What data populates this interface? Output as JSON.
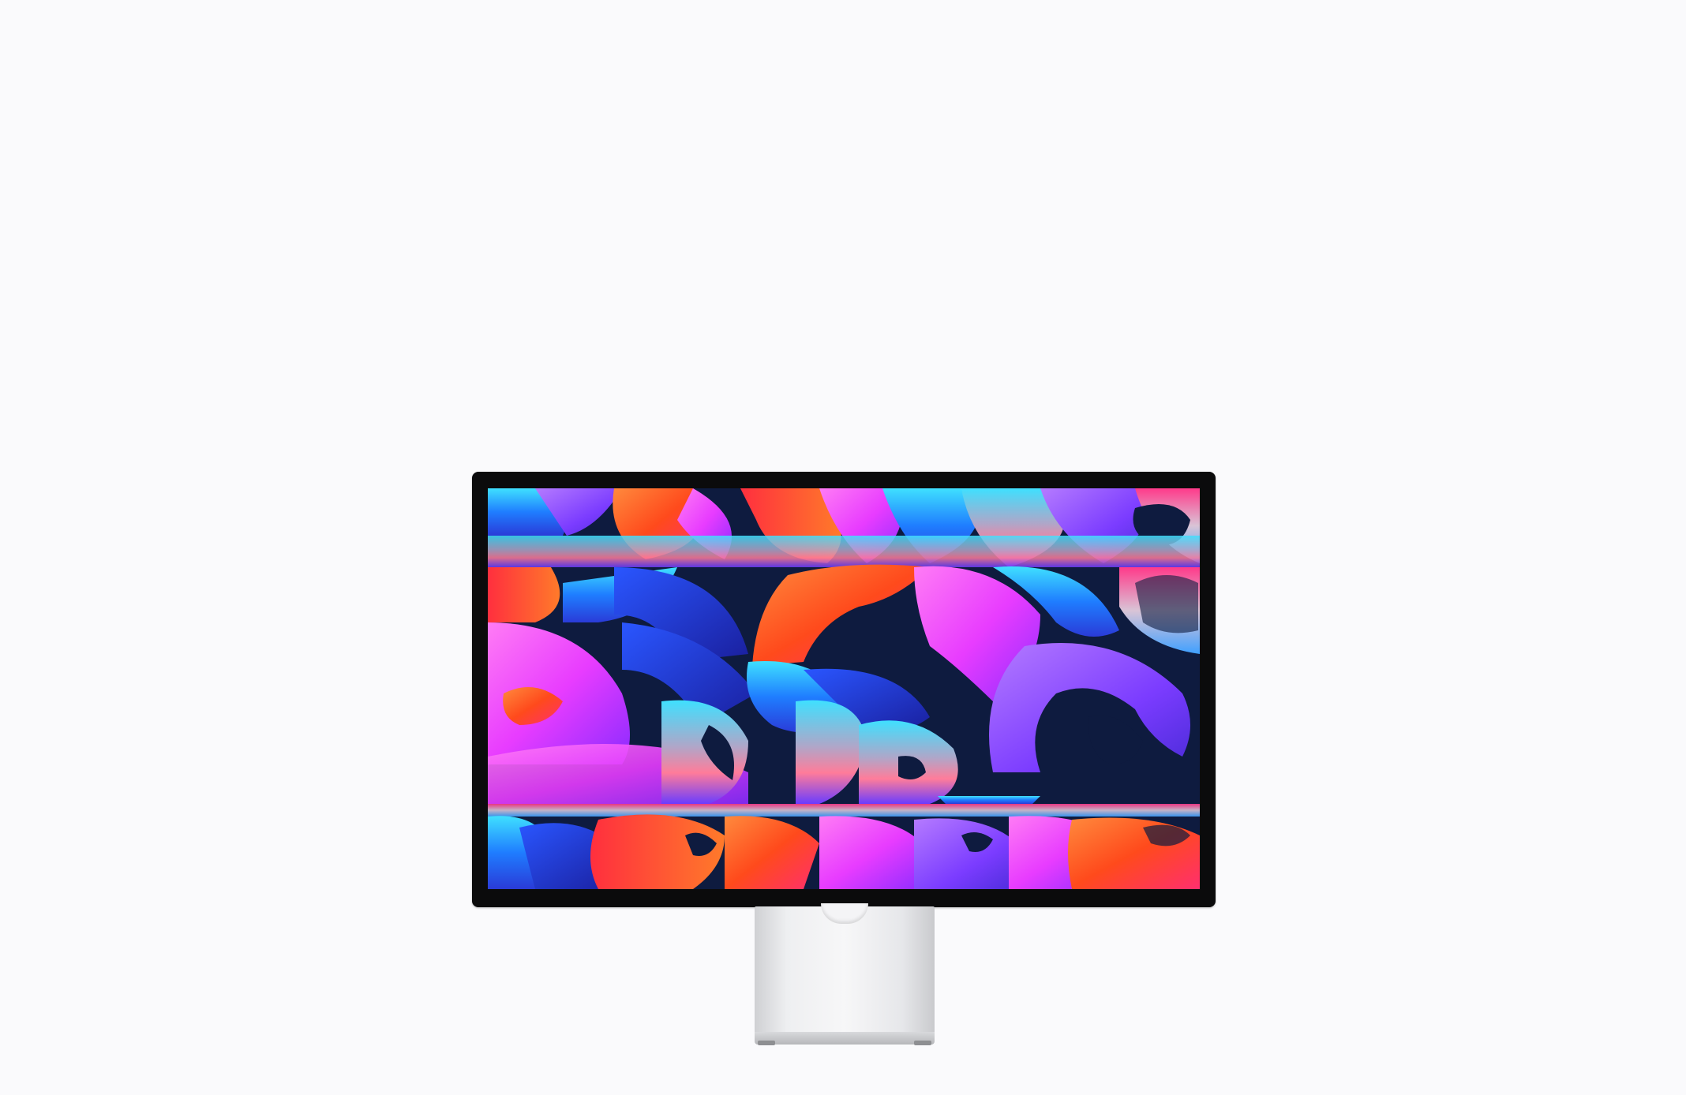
{
  "scene": {
    "subject": "display-monitor-on-stand",
    "background_color": "#fafafc",
    "bezel_color": "#0b0b0c",
    "stand_color": "#e6e7ea",
    "wallpaper_palette": [
      "#0e1b3f",
      "#ff5a1f",
      "#ff2f6e",
      "#c43cff",
      "#6b3cff",
      "#1fb6ff",
      "#2a56ff",
      "#ff8a3d",
      "#e83cff",
      "#3fe0ff"
    ]
  }
}
